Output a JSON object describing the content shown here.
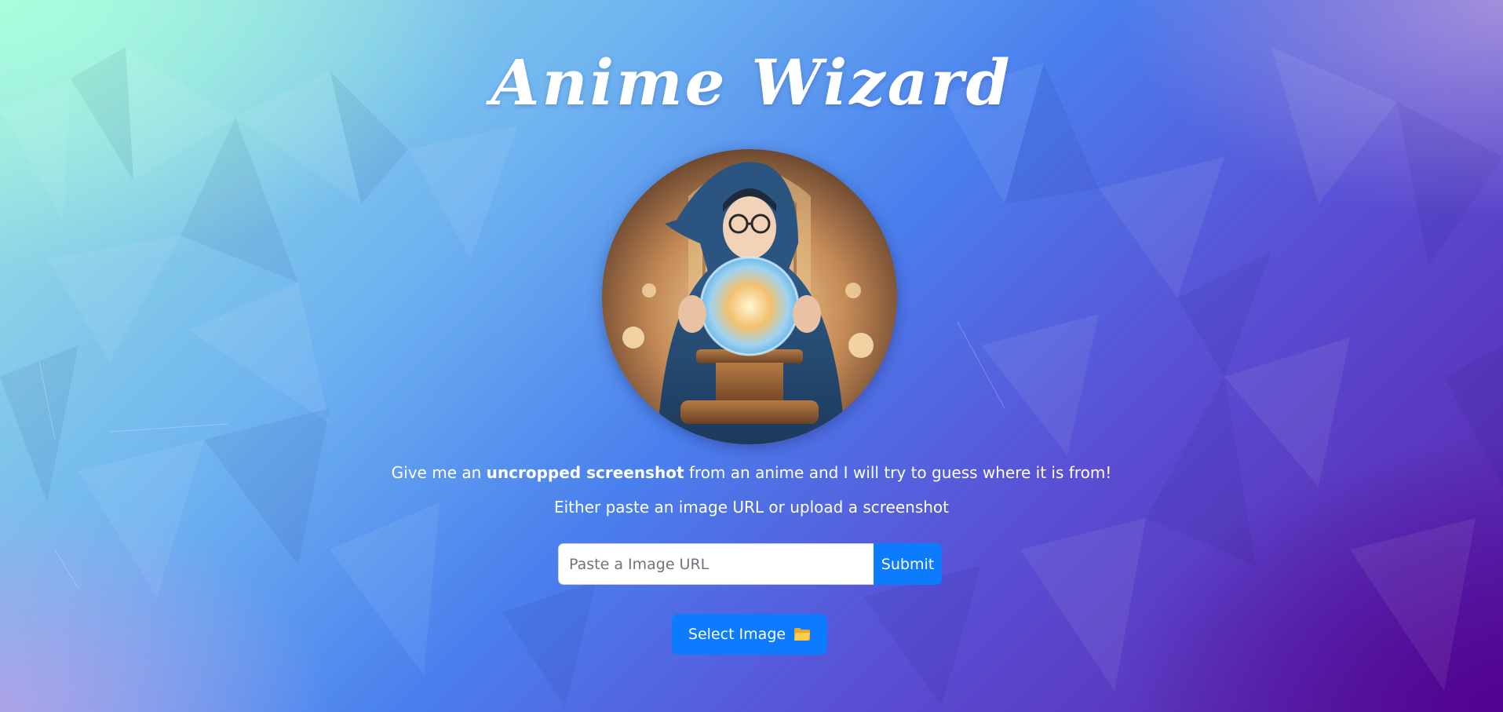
{
  "page": {
    "title": "Anime Wizard",
    "avatar_alt": "wizard-with-crystal-ball"
  },
  "intro": {
    "prefix": "Give me an ",
    "bold": "uncropped screenshot",
    "suffix": " from an anime and I will try to guess where it is from!",
    "line2": "Either paste an image URL or upload a screenshot"
  },
  "url_form": {
    "placeholder": "Paste a Image URL",
    "value": "",
    "submit_label": "Submit"
  },
  "upload": {
    "label": "Select Image",
    "icon": "folder-icon"
  },
  "colors": {
    "accent": "#0d7bfd",
    "bg_top_left": "#9fe9e0",
    "bg_bottom_right": "#5a1fa8"
  }
}
